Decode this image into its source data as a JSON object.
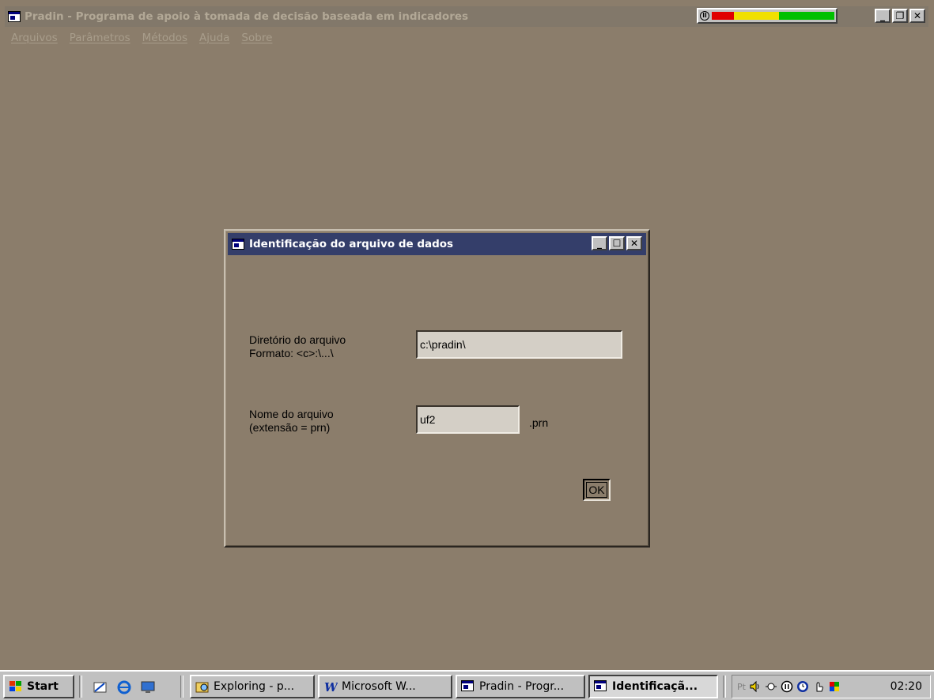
{
  "main_window": {
    "title": "Pradin - Programa de apoio à tomada de decisão baseada em indicadores",
    "menu": [
      "Arquivos",
      "Parâmetros",
      "Métodos",
      "Ajuda",
      "Sobre"
    ]
  },
  "dialog": {
    "title": "Identificação do arquivo de dados",
    "dir_label_line1": "Diretório do arquivo",
    "dir_label_line2": "Formato:  <c>:\\...\\",
    "dir_value": "c:\\pradin\\",
    "name_label_line1": "Nome do arquivo",
    "name_label_line2": "(extensão = prn)",
    "name_value": "uf2",
    "extension": ".prn",
    "ok_label": "OK"
  },
  "taskbar": {
    "start_label": "Start",
    "tasks": [
      {
        "label": "Exploring - p...",
        "icon": "explorer-icon",
        "active": false
      },
      {
        "label": "Microsoft W...",
        "icon": "word-icon",
        "active": false
      },
      {
        "label": "Pradin - Progr...",
        "icon": "app-window-icon",
        "active": false
      },
      {
        "label": "Identificaçã...",
        "icon": "app-window-icon",
        "active": true
      }
    ],
    "tray_lang": "Pt",
    "clock": "02:20"
  },
  "colors": {
    "desktop": "#8b7d6b",
    "dialog_title_bar": "#343e6a",
    "taskbar": "#c0c0c0"
  }
}
